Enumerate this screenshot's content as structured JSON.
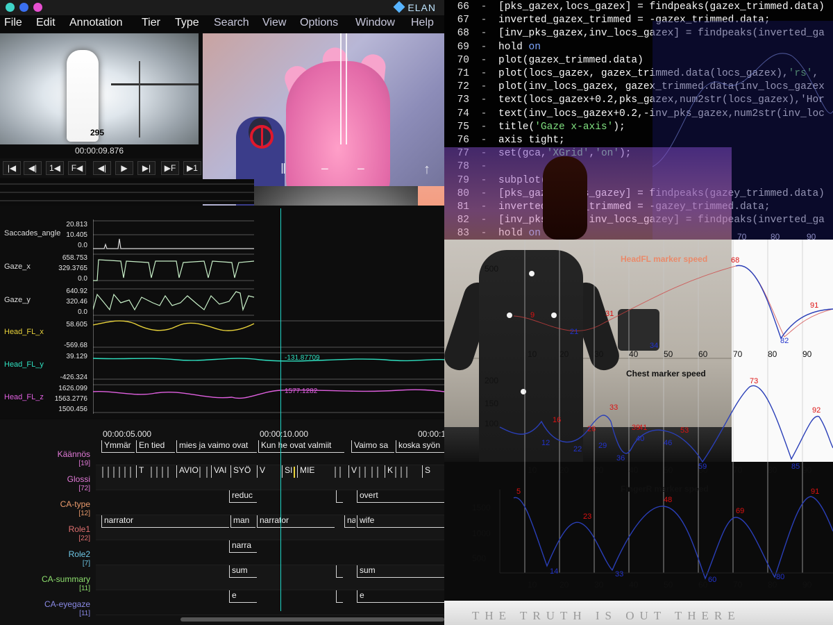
{
  "elan": {
    "window_title": "ELAN",
    "menu": [
      "File",
      "Edit",
      "Annotation",
      "Tier",
      "Type",
      "Search",
      "View",
      "Options",
      "Window",
      "Help"
    ],
    "thermal_number": "295",
    "timecode": "00:00:09.876",
    "transport": [
      "|◀",
      "◀|",
      "1◀",
      "F◀",
      "◀|",
      "▶",
      "▶|",
      "▶F",
      "▶1"
    ],
    "signals": [
      {
        "label": "Saccades_angle",
        "color": "#e6e6e6",
        "max": "20.813",
        "mid": "10.405",
        "min": "0.0"
      },
      {
        "label": "Gaze_x",
        "color": "#e6e6e6",
        "max": "658.753",
        "mid": "329.3765",
        "min": "0.0"
      },
      {
        "label": "Gaze_y",
        "color": "#e6e6e6",
        "max": "640.92",
        "mid": "320.46",
        "min": "0.0"
      },
      {
        "label": "Head_FL_x",
        "color": "#e8d23a",
        "max": "58.605",
        "mid": "",
        "min": "-569.68"
      },
      {
        "label": "Head_FL_y",
        "color": "#2fe0c0",
        "max": "39.129",
        "mid": "",
        "min": "-426.324"
      },
      {
        "label": "Head_FL_z",
        "color": "#e060e0",
        "max": "1626.099",
        "mid": "1563.2776",
        "min": "1500.456"
      }
    ],
    "signal_readouts": {
      "head_fl_y": "-131.87709",
      "head_fl_z": "1577.1282"
    },
    "ruler": [
      "00:00:05.000",
      "00:00:10.000",
      "00:00:1"
    ],
    "tiers": [
      {
        "name": "Käännös",
        "count": "[19]",
        "color": "#e27ad8"
      },
      {
        "name": "Glossi",
        "count": "[72]",
        "color": "#e27ad8"
      },
      {
        "name": "CA-type",
        "count": "[12]",
        "color": "#e99a6c"
      },
      {
        "name": "Role1",
        "count": "[22]",
        "color": "#e07070"
      },
      {
        "name": "Role2",
        "count": "[7]",
        "color": "#6ec7e6"
      },
      {
        "name": "CA-summary",
        "count": "[11]",
        "color": "#8ee06e"
      },
      {
        "name": "CA-eyegaze",
        "count": "[11]",
        "color": "#8a8ae6"
      }
    ],
    "annotations": {
      "kaannos": [
        "Ymmär",
        "En tied",
        "mies ja vaimo ovat",
        "Kun he ovat valmiit",
        "Vaimo sa",
        "koska syön"
      ],
      "glossi": [
        "T",
        "AVIO",
        "VAI",
        "SYÖ",
        "V",
        "SI",
        "MIE",
        "V",
        "K",
        "S"
      ],
      "ca_type": [
        "reduc",
        "overt"
      ],
      "role1": [
        "narrator",
        "man",
        "narrator",
        "na",
        "wife"
      ],
      "role2": [
        "narra"
      ],
      "ca_summary": [
        "sum",
        "sum"
      ],
      "ca_eyegaze": [
        "e",
        "e"
      ]
    }
  },
  "code": {
    "lines": [
      {
        "n": "66",
        "t": "[pks_gazex,locs_gazex] = findpeaks(gazex_trimmed.data)"
      },
      {
        "n": "67",
        "t": "inverted_gazex_trimmed = -gazex_trimmed.data;"
      },
      {
        "n": "68",
        "t": "[inv_pks_gazex,inv_locs_gazex] = findpeaks(inverted_ga"
      },
      {
        "n": "69",
        "t": "hold on"
      },
      {
        "n": "70",
        "t": "plot(gazex_trimmed.data)"
      },
      {
        "n": "71",
        "t": "plot(locs_gazex, gazex_trimmed.data(locs_gazex),'rs',"
      },
      {
        "n": "72",
        "t": "plot(inv_locs_gazex, gazex_trimmed.data(inv_locs_gazex"
      },
      {
        "n": "73",
        "t": "text(locs_gazex+0.2,pks_gazex,num2str(locs_gazex),'Hor"
      },
      {
        "n": "74",
        "t": "text(inv_locs_gazex+0.2,-inv_pks_gazex,num2str(inv_loc"
      },
      {
        "n": "75",
        "t": "title('Gaze x-axis');"
      },
      {
        "n": "76",
        "t": "axis tight;"
      },
      {
        "n": "77",
        "t": "set(gca,'XGrid','on');"
      },
      {
        "n": "78",
        "t": ""
      },
      {
        "n": "79",
        "t": "subplot(5,1,2);"
      },
      {
        "n": "80",
        "t": "[pks_gazey,locs_gazey] = findpeaks(gazey_trimmed.data)"
      },
      {
        "n": "81",
        "t": "inverted_gazey_trimmed = -gazey_trimmed.data;"
      },
      {
        "n": "82",
        "t": "[inv_pks_gazey,inv_locs_gazey] = findpeaks(inverted_ga"
      },
      {
        "n": "83",
        "t": "hold on"
      }
    ],
    "ghost_ticks": [
      "70",
      "80",
      "90"
    ]
  },
  "plots": {
    "headfl_title": "HeadFL marker speed",
    "chest_title": "Chest marker speed",
    "finger_title": "FingerR marker speed",
    "x_ticks": [
      "10",
      "20",
      "30",
      "40",
      "50",
      "60",
      "70",
      "80",
      "90"
    ],
    "headfl_y_ticks": [
      "500"
    ],
    "chest_y_ticks": [
      "200",
      "150",
      "100"
    ],
    "finger_y_ticks": [
      "1500",
      "1000",
      "500"
    ],
    "headfl_peaks": [
      "68",
      "91",
      "9",
      "31"
    ],
    "headfl_troughs": [
      "21",
      "82",
      "34"
    ],
    "chest_peaks": [
      "73",
      "92",
      "33",
      "16",
      "26",
      "39",
      "41",
      "53"
    ],
    "chest_troughs": [
      "12",
      "22",
      "29",
      "36",
      "40",
      "46",
      "59",
      "85"
    ],
    "finger_peaks": [
      "5",
      "23",
      "48",
      "69",
      "91"
    ],
    "finger_troughs": [
      "14",
      "33",
      "60",
      "80"
    ]
  },
  "banner": "THE TRUTH IS OUT THERE"
}
